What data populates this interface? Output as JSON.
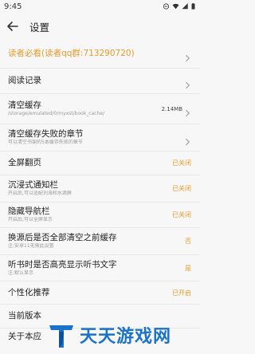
{
  "status_bar": {
    "time": "9:45"
  },
  "app_bar": {
    "title": "设置"
  },
  "settings": [
    {
      "id": "readers",
      "title": "读者必看(读者qq群:713290720)",
      "subtitle": "",
      "value": "",
      "size": "",
      "chevron": true,
      "title_color": "#e69a2c"
    },
    {
      "id": "history",
      "title": "阅读记录",
      "subtitle": "",
      "value": "",
      "size": "",
      "chevron": true
    },
    {
      "id": "cache",
      "title": "清空缓存",
      "subtitle": "/storage/emulated/0/myxst/book_cache/",
      "value": "",
      "size": "2.14MB",
      "chevron": true
    },
    {
      "id": "failed",
      "title": "清空缓存失败的章节",
      "subtitle": "可以清空书架的5本缓存失败的章节",
      "value": "",
      "size": "",
      "chevron": true
    },
    {
      "id": "fullscreen",
      "title": "全屏翻页",
      "subtitle": "",
      "value": "已关闭",
      "size": "",
      "chevron": false
    },
    {
      "id": "immersive",
      "title": "沉浸式通知栏",
      "subtitle": "开启后,可以适配刘海和水滴屏",
      "value": "已关闭",
      "size": "",
      "chevron": false
    },
    {
      "id": "navbar",
      "title": "隐藏导航栏",
      "subtitle": "开启后,可以全屏显示",
      "value": "已关闭",
      "size": "",
      "chevron": false
    },
    {
      "id": "switch",
      "title": "换源后是否全部清空之前缓存",
      "subtitle": "注:安卓11无需此设置",
      "value": "否",
      "size": "",
      "chevron": false
    },
    {
      "id": "highlight",
      "title": "听书时是否高亮显示听书文字",
      "subtitle": "注:默认显示",
      "value": "是",
      "size": "",
      "chevron": false
    },
    {
      "id": "recommend",
      "title": "个性化推荐",
      "subtitle": "",
      "value": "已开启",
      "size": "",
      "chevron": false
    },
    {
      "id": "version",
      "title": "当前版本",
      "subtitle": "",
      "value": "",
      "size": "",
      "chevron": false
    },
    {
      "id": "cut",
      "title": "关于本应",
      "subtitle": "",
      "value": "",
      "size": "",
      "chevron": false
    }
  ],
  "watermark": {
    "text": "天天游戏网"
  },
  "colors": {
    "accent": "#e69a2c",
    "watermark": "#1a73c8"
  }
}
